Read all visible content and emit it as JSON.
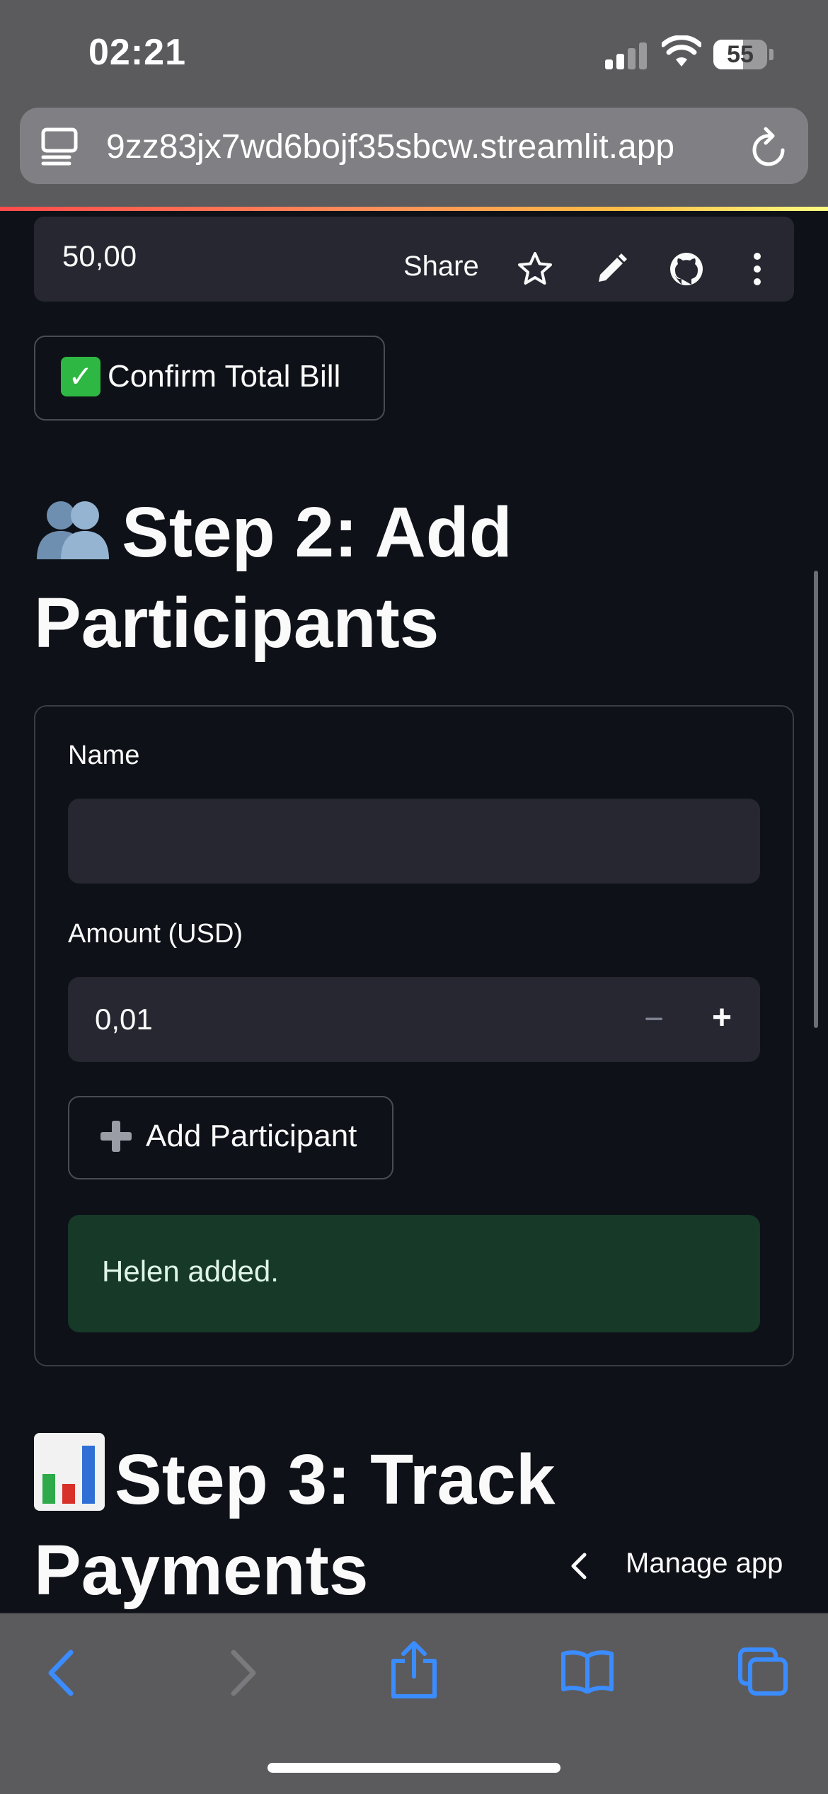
{
  "status": {
    "time": "02:21",
    "battery": "55",
    "battery_percent": 55
  },
  "browser": {
    "url": "9zz83jx7wd6bojf35sbcw.streamlit.app"
  },
  "app_header": {
    "value": "50,00",
    "share_label": "Share",
    "icons": [
      "star-icon",
      "pencil-icon",
      "github-icon",
      "more-icon"
    ]
  },
  "confirm_button": {
    "emoji": "✅",
    "label": "Confirm Total Bill"
  },
  "step2": {
    "emoji": "👥",
    "title": "Step 2: Add Participants"
  },
  "form": {
    "name_label": "Name",
    "name_value": "",
    "amount_label": "Amount (USD)",
    "amount_value": "0,01",
    "minus": "−",
    "plus": "+",
    "add_button": "Add Participant",
    "success_message": "Helen added."
  },
  "step3": {
    "emoji": "📊",
    "title": "Step 3: Track Payments"
  },
  "manage_app": "Manage app",
  "colors": {
    "background": "#0e1117",
    "widget": "#262730",
    "success_bg": "#173928",
    "accent_blue": "#3b8cff"
  }
}
